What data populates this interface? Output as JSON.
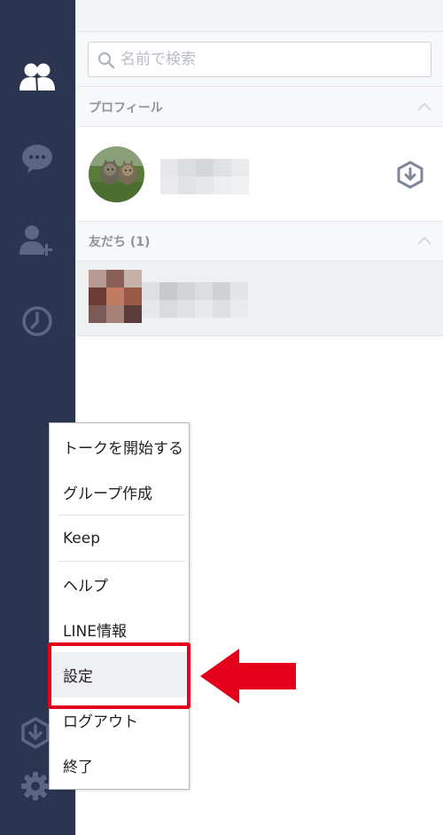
{
  "search": {
    "placeholder": "名前で検索"
  },
  "sections": {
    "profile": {
      "label": "プロフィール"
    },
    "friends": {
      "label": "友だち (1)"
    }
  },
  "sidebar": {
    "icons": [
      "friends-icon",
      "chat-icon",
      "add-friend-icon",
      "timeline-icon",
      "download-icon",
      "settings-gear-icon"
    ]
  },
  "menu": {
    "items": [
      {
        "label": "トークを開始する"
      },
      {
        "label": "グループ作成"
      },
      {
        "label": "Keep"
      },
      {
        "label": "ヘルプ"
      },
      {
        "label": "LINE情報"
      },
      {
        "label": "設定"
      },
      {
        "label": "ログアウト"
      },
      {
        "label": "終了"
      }
    ]
  },
  "colors": {
    "sidebar": "#2c3550",
    "sidebar_icon": "#5b6685",
    "sidebar_icon_active": "#ffffff",
    "highlight": "#e4001a"
  }
}
